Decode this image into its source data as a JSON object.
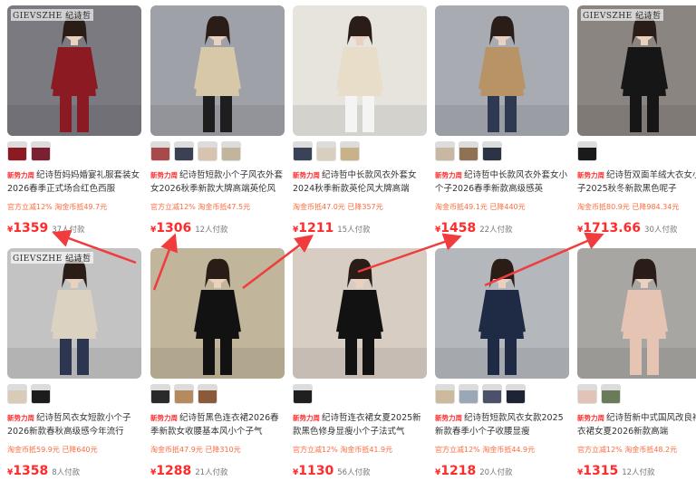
{
  "brand_watermark": "GIEVSZHE",
  "brand_watermark_alt": "GIEVSZHE 纪诗哲",
  "tag_label": "新势力周",
  "yen": "¥",
  "products": [
    {
      "title": "纪诗哲妈妈婚宴礼服套装女2026春季正式场合红色西服",
      "sub": "官方立减12%  淘金币抵49.7元",
      "price": "1359",
      "buyers": "37人付款",
      "colors": {
        "bg": "#7a7a80",
        "coat": "#8b1a22",
        "pants": "#8b1a22"
      },
      "thumbs": [
        "#8b1a22",
        "#7b2030"
      ]
    },
    {
      "title": "纪诗哲短款小个子风衣外套女2026秋季新款大牌高端英伦风",
      "sub": "官方立减12%  淘金币抵47.5元",
      "price": "1306",
      "buyers": "12人付款",
      "colors": {
        "bg": "#9fa1a8",
        "coat": "#d8c8aa",
        "pants": "#1e1e1e"
      },
      "thumbs": [
        "#a8494a",
        "#3b4153",
        "#d7c3b0",
        "#c2b59c"
      ]
    },
    {
      "title": "纪诗哲中长款风衣外套女2024秋季新款英伦风大牌高端",
      "sub": "淘金币抵47.0元  已降357元",
      "price": "1211",
      "buyers": "15人付款",
      "colors": {
        "bg": "#e7e4de",
        "coat": "#e8ddc8",
        "pants": "#f4f4f4"
      },
      "thumbs": [
        "#3a4258",
        "#d9cfbf",
        "#c9b18a"
      ]
    },
    {
      "title": "纪诗哲中长款风衣外套女小个子2026春季新款高级感英",
      "sub": "淘金币抵49.1元  已降440元",
      "price": "1458",
      "buyers": "22人付款",
      "colors": {
        "bg": "#a9abb2",
        "coat": "#b89366",
        "pants": "#2f3a52"
      },
      "thumbs": [
        "#c7b7a3",
        "#8f7252",
        "#2b3344"
      ]
    },
    {
      "title": "纪诗哲双面羊绒大衣女小个子2025秋冬新款黑色呢子",
      "sub": "淘金币抵80.9元  已降984.34元",
      "price": "1713.66",
      "buyers": "30人付款",
      "colors": {
        "bg": "#8a8580",
        "coat": "#161616",
        "pants": "#161616"
      },
      "thumbs": [
        "#1a1a1a"
      ]
    },
    {
      "title": "纪诗哲风衣女短款小个子2026新款春秋高级感今年流行",
      "sub": "淘金币抵59.9元  已降640元",
      "price": "1358",
      "buyers": "8人付款",
      "colors": {
        "bg": "#c3c3c3",
        "coat": "#dcd2c2",
        "pants": "#2c3650"
      },
      "thumbs": [
        "#d8ccb8",
        "#1c1c1c"
      ]
    },
    {
      "title": "纪诗哲黑色连衣裙2026春季新款女收腰基本风小个子气",
      "sub": "淘金币抵47.9元  已降310元",
      "price": "1288",
      "buyers": "21人付款",
      "colors": {
        "bg": "#c1b59b",
        "coat": "#121212",
        "pants": "#121212"
      },
      "thumbs": [
        "#2a2a2a",
        "#b48a5e",
        "#8a5a3a"
      ]
    },
    {
      "title": "纪诗哲连衣裙女夏2025新款黑色修身显瘦小个子法式气",
      "sub": "官方立减12%  淘金币抵41.9元",
      "price": "1130",
      "buyers": "56人付款",
      "colors": {
        "bg": "#d7cdc3",
        "coat": "#121212",
        "pants": "#121212"
      },
      "thumbs": [
        "#1f1f1f"
      ]
    },
    {
      "title": "纪诗哲短款风衣女款2025新款春季小个子收腰显瘦",
      "sub": "官方立减12%  淘金币抵44.9元",
      "price": "1218",
      "buyers": "20人付款",
      "colors": {
        "bg": "#b4b7bc",
        "coat": "#1f2a44",
        "pants": "#1f2a44"
      },
      "thumbs": [
        "#cdb99c",
        "#99a7b7",
        "#4a5168",
        "#1e2436"
      ]
    },
    {
      "title": "纪诗哲新中式国风改良袍连衣裙女夏2026新款高端",
      "sub": "官方立减12%  淘金币抵48.2元",
      "price": "1315",
      "buyers": "12人付款",
      "colors": {
        "bg": "#a8a6a2",
        "coat": "#e6c4b4",
        "pants": "#e6c4b4"
      },
      "thumbs": [
        "#e2c3b7",
        "#6a7b5a"
      ]
    }
  ]
}
